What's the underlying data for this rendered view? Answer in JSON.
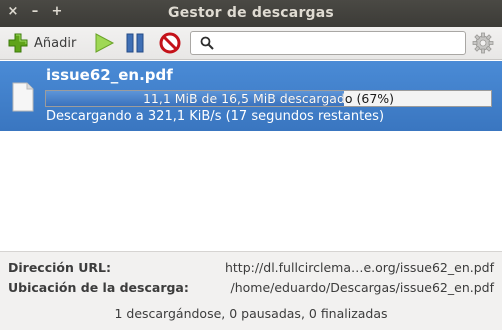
{
  "window": {
    "title": "Gestor de descargas",
    "close_glyph": "×",
    "minimize_glyph": "–",
    "maximize_glyph": "+"
  },
  "toolbar": {
    "add_label": "Añadir",
    "icons": [
      "add-icon",
      "play-icon",
      "pause-icon",
      "stop-icon",
      "search-icon",
      "gear-icon"
    ],
    "search": {
      "value": "",
      "placeholder": ""
    }
  },
  "downloads": [
    {
      "filename": "issue62_en.pdf",
      "progress_text": "11,1 MiB de 16,5 MiB descargado (67%)",
      "progress_percent": 67,
      "status": "Descargando a 321,1 KiB/s (17 segundos restantes)",
      "selected": true
    }
  ],
  "details": {
    "url_label": "Dirección URL:",
    "url_value": "http://dl.fullcirclema…e.org/issue62_en.pdf",
    "location_label": "Ubicación de la descarga:",
    "location_value": "/home/eduardo/Descargas/issue62_en.pdf",
    "summary": "1 descargándose, 0 pausadas, 0 finalizadas"
  },
  "colors": {
    "selection": "#3d7bc5",
    "titlebar": "#3c3b37",
    "add_green": "#4e9a06",
    "play_green": "#8ae234",
    "pause_blue": "#3465a4",
    "stop_red": "#cc0000"
  }
}
